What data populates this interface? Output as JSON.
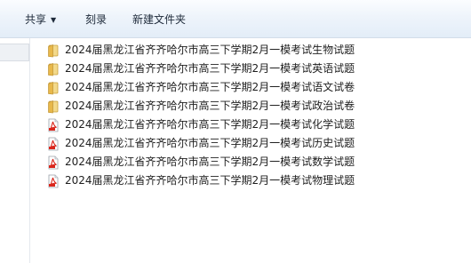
{
  "toolbar": {
    "share_label": "共享",
    "burn_label": "刻录",
    "new_folder_label": "新建文件夹"
  },
  "files": [
    {
      "name": "2024届黑龙江省齐齐哈尔市高三下学期2月一模考试生物试题",
      "icon": "folder-icon"
    },
    {
      "name": "2024届黑龙江省齐齐哈尔市高三下学期2月一模考试英语试题",
      "icon": "folder-icon"
    },
    {
      "name": "2024届黑龙江省齐齐哈尔市高三下学期2月一模考试语文试卷",
      "icon": "folder-icon"
    },
    {
      "name": "2024届黑龙江省齐齐哈尔市高三下学期2月一模考试政治试卷",
      "icon": "folder-icon"
    },
    {
      "name": "2024届黑龙江省齐齐哈尔市高三下学期2月一模考试化学试题",
      "icon": "pdf-icon"
    },
    {
      "name": "2024届黑龙江省齐齐哈尔市高三下学期2月一模考试历史试题",
      "icon": "pdf-icon"
    },
    {
      "name": "2024届黑龙江省齐齐哈尔市高三下学期2月一模考试数学试题",
      "icon": "pdf-icon"
    },
    {
      "name": "2024届黑龙江省齐齐哈尔市高三下学期2月一模考试物理试题",
      "icon": "pdf-icon"
    }
  ],
  "colors": {
    "folder": "#e8b84a",
    "pdf_red": "#d9261c"
  }
}
